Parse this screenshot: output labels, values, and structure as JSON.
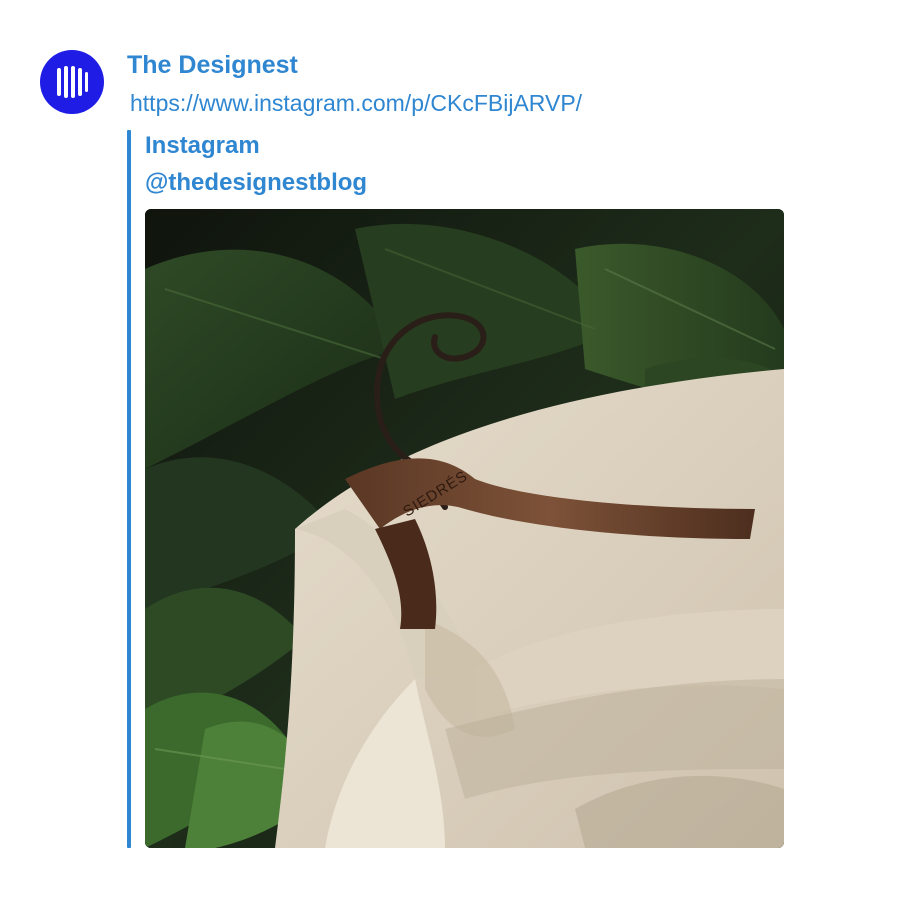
{
  "message": {
    "author": "The Designest",
    "avatar_icon": "designest-logo-icon",
    "avatar_color": "#1f1ce6",
    "link": "https://www.instagram.com/p/CKcFBijARVP/"
  },
  "embed": {
    "provider": "Instagram",
    "title": "@thedesignestblog",
    "accent_color": "#2f86d1",
    "image": {
      "brand_text": "SIEDRÉS",
      "icon": "photo-hanger-shirt-icon"
    }
  }
}
